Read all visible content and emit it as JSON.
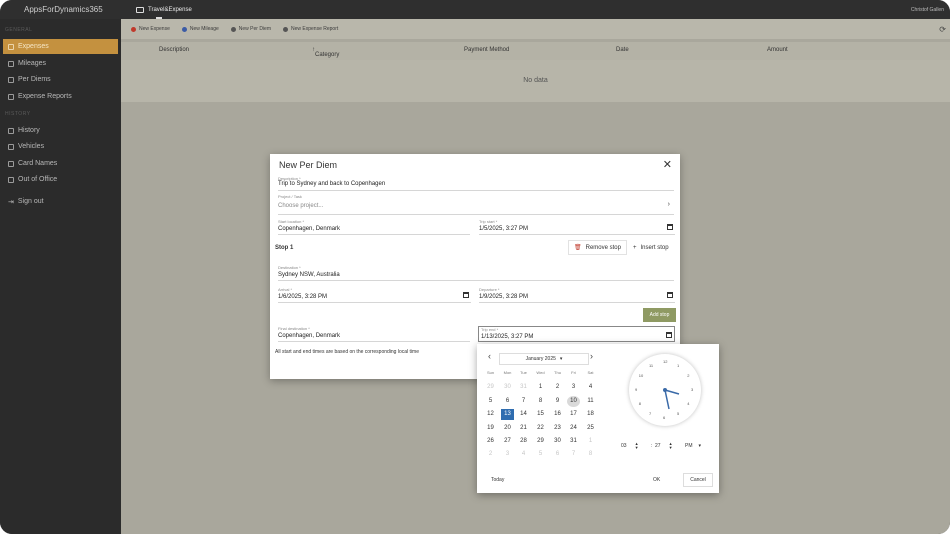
{
  "app": {
    "title": "AppsForDynamics365",
    "tab": "Travel&Expense",
    "user": "Christof Gallen"
  },
  "sidebar": {
    "section1": "GENERAL",
    "items": [
      {
        "label": "Expenses",
        "icon": "receipt-icon"
      },
      {
        "label": "Mileages",
        "icon": "car-icon"
      },
      {
        "label": "Per Diems",
        "icon": "person-icon"
      },
      {
        "label": "Expense Reports",
        "icon": "report-icon"
      }
    ],
    "section2": "HISTORY",
    "items2": [
      {
        "label": "History",
        "icon": "history-icon"
      },
      {
        "label": "Vehicles",
        "icon": "vehicle-icon"
      },
      {
        "label": "Card Names",
        "icon": "card-icon"
      },
      {
        "label": "Out of Office",
        "icon": "calendar-icon"
      }
    ],
    "signout": "Sign out"
  },
  "toolbar": {
    "buttons": [
      {
        "label": "New Expense",
        "color": "#c0392b"
      },
      {
        "label": "New Mileage",
        "color": "#3b5ba5"
      },
      {
        "label": "New Per Diem",
        "color": "#555555"
      },
      {
        "label": "New Expense Report",
        "color": "#555555"
      }
    ]
  },
  "grid": {
    "columns": [
      "Description",
      "Category",
      "Payment Method",
      "Date",
      "Amount"
    ],
    "empty": "No data"
  },
  "dialog": {
    "title": "New Per Diem",
    "description": {
      "label": "Description *",
      "value": "Trip to Sydney and back to Copenhagen"
    },
    "project": {
      "label": "Project / Task",
      "placeholder": "Choose project..."
    },
    "start_dest": {
      "label": "Start location *",
      "value": "Copenhagen, Denmark"
    },
    "trip_start": {
      "label": "Trip start *",
      "value": "1/5/2025, 3:27 PM"
    },
    "stop": {
      "label": "Stop 1",
      "remove": "Remove stop",
      "insert": "Insert stop"
    },
    "destination": {
      "label": "Destination *",
      "value": "Sydney NSW, Australia"
    },
    "arrival": {
      "label": "Arrival *",
      "value": "1/6/2025, 3:28 PM"
    },
    "departure": {
      "label": "Departure *",
      "value": "1/9/2025, 3:28 PM"
    },
    "add_stop": "Add stop",
    "final_dest": {
      "label": "Final destination *",
      "value": "Copenhagen, Denmark"
    },
    "trip_end": {
      "label": "Trip end *",
      "value": "1/13/2025, 3:27 PM"
    },
    "note": "All start and end times are based on the corresponding local time"
  },
  "picker": {
    "month": "January 2025",
    "weekdays": [
      "Sun",
      "Mon",
      "Tue",
      "Wed",
      "Thu",
      "Fri",
      "Sat"
    ],
    "weeks": [
      [
        "29",
        "30",
        "31",
        "1",
        "2",
        "3",
        "4"
      ],
      [
        "5",
        "6",
        "7",
        "8",
        "9",
        "10",
        "11"
      ],
      [
        "12",
        "13",
        "14",
        "15",
        "16",
        "17",
        "18"
      ],
      [
        "19",
        "20",
        "21",
        "22",
        "23",
        "24",
        "25"
      ],
      [
        "26",
        "27",
        "28",
        "29",
        "30",
        "31",
        "1"
      ],
      [
        "2",
        "3",
        "4",
        "5",
        "6",
        "7",
        "8"
      ]
    ],
    "selected": "13",
    "hours": [
      "12",
      "1",
      "2",
      "3",
      "4",
      "5",
      "6",
      "7",
      "8",
      "9",
      "10",
      "11"
    ],
    "time": {
      "hour": "03",
      "minute": "27",
      "ampm": "PM"
    },
    "today": "Today",
    "ok": "OK",
    "cancel": "Cancel"
  }
}
